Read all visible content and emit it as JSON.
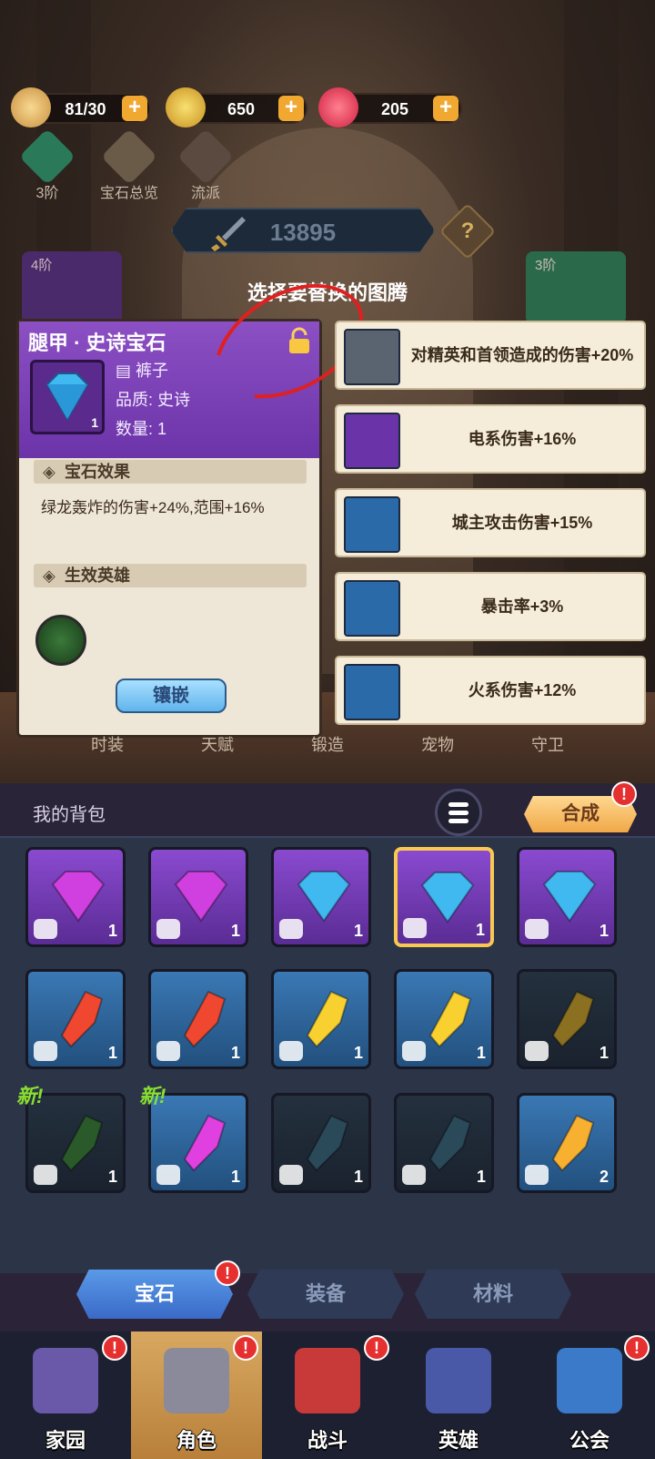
{
  "resources": [
    {
      "name": "stamina",
      "value": "81/30",
      "icon": "bread-icon"
    },
    {
      "name": "gold",
      "value": "650",
      "icon": "gold-coin-icon"
    },
    {
      "name": "gem",
      "value": "205",
      "icon": "red-gem-icon"
    }
  ],
  "top_icons": [
    {
      "label": "3阶",
      "icon": "tier-gem-icon"
    },
    {
      "label": "宝石总览",
      "icon": "gem-overview-icon"
    },
    {
      "label": "流派",
      "icon": "school-icon"
    }
  ],
  "power": "13895",
  "help": "?",
  "select_title": "选择要替换的图腾",
  "side_cards": {
    "left_tier": "4阶",
    "right_tier": "3阶"
  },
  "detail": {
    "title": "腿甲 · 史诗宝石",
    "slot_name": "裤子",
    "quality": "品质: 史诗",
    "quantity": "数量: 1",
    "count": "1",
    "effect_header": "宝石效果",
    "effect_text": "绿龙轰炸的伤害+24%,范围+16%",
    "hero_header": "生效英雄",
    "inlay_button": "镶嵌"
  },
  "options": [
    {
      "text": "对精英和首领造成的伤害+20%",
      "style": "gray"
    },
    {
      "text": "电系伤害+16%",
      "style": "purple"
    },
    {
      "text": "城主攻击伤害+15%",
      "style": "blue"
    },
    {
      "text": "暴击率+3%",
      "style": "blue"
    },
    {
      "text": "火系伤害+12%",
      "style": "blue"
    }
  ],
  "sub_tabs": [
    "时装",
    "天赋",
    "锻造",
    "宠物",
    "守卫"
  ],
  "bag": {
    "title": "我的背包",
    "compose_label": "合成",
    "alert": "!",
    "new_label": "新!"
  },
  "grid": [
    {
      "bg": "purple",
      "gem": "#d040e0",
      "shape": "round",
      "count": "1"
    },
    {
      "bg": "purple",
      "gem": "#d040e0",
      "shape": "round",
      "count": "1"
    },
    {
      "bg": "purple",
      "gem": "#40b8f0",
      "shape": "round",
      "count": "1"
    },
    {
      "bg": "purple",
      "gem": "#40b8f0",
      "shape": "round",
      "count": "1",
      "selected": true
    },
    {
      "bg": "purple",
      "gem": "#40b8f0",
      "shape": "round",
      "count": "1"
    },
    {
      "bg": "blue",
      "gem": "#f04830",
      "shape": "long",
      "count": "1"
    },
    {
      "bg": "blue",
      "gem": "#f04830",
      "shape": "long",
      "count": "1"
    },
    {
      "bg": "blue",
      "gem": "#f8d030",
      "shape": "long",
      "count": "1"
    },
    {
      "bg": "blue",
      "gem": "#f8d030",
      "shape": "long",
      "count": "1"
    },
    {
      "bg": "dark",
      "gem": "#8a7020",
      "shape": "long",
      "count": "1"
    },
    {
      "bg": "dark",
      "gem": "#2a5a2a",
      "shape": "long",
      "count": "1",
      "isnew": true
    },
    {
      "bg": "blue",
      "gem": "#e040e0",
      "shape": "long",
      "count": "1",
      "isnew": true
    },
    {
      "bg": "dark",
      "gem": "#2a4a5a",
      "shape": "long",
      "count": "1"
    },
    {
      "bg": "dark",
      "gem": "#2a4a5a",
      "shape": "long",
      "count": "1"
    },
    {
      "bg": "blue",
      "gem": "#f8b030",
      "shape": "long",
      "count": "2"
    }
  ],
  "categories": [
    {
      "label": "宝石",
      "active": true
    },
    {
      "label": "装备",
      "active": false
    },
    {
      "label": "材料",
      "active": false
    }
  ],
  "nav": [
    {
      "label": "家园",
      "active": false
    },
    {
      "label": "角色",
      "active": true
    },
    {
      "label": "战斗",
      "active": false
    },
    {
      "label": "英雄",
      "active": false
    },
    {
      "label": "公会",
      "active": false
    }
  ]
}
